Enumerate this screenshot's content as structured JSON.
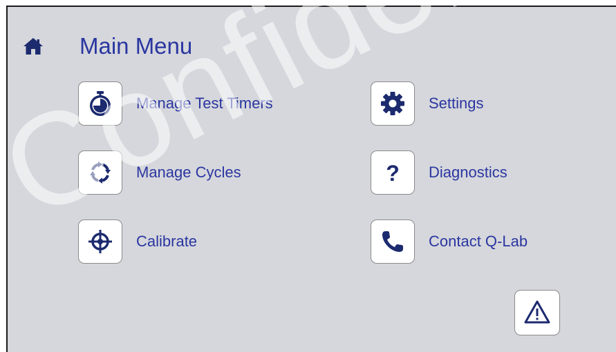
{
  "header": {
    "title": "Main Menu",
    "home_icon": "home-icon"
  },
  "menu": {
    "items": [
      {
        "label": "Manage Test Timers",
        "icon": "stopwatch-icon"
      },
      {
        "label": "Manage Cycles",
        "icon": "cycle-icon"
      },
      {
        "label": "Calibrate",
        "icon": "crosshair-icon"
      },
      {
        "label": "Settings",
        "icon": "gear-icon"
      },
      {
        "label": "Diagnostics",
        "icon": "question-icon"
      },
      {
        "label": "Contact Q-Lab",
        "icon": "phone-icon"
      }
    ]
  },
  "alert": {
    "icon": "warning-icon"
  },
  "watermark": {
    "text": "Confidential"
  },
  "colors": {
    "background": "#d6d7dc",
    "accent": "#2a36a0",
    "icon_dark": "#1c2a6e"
  }
}
